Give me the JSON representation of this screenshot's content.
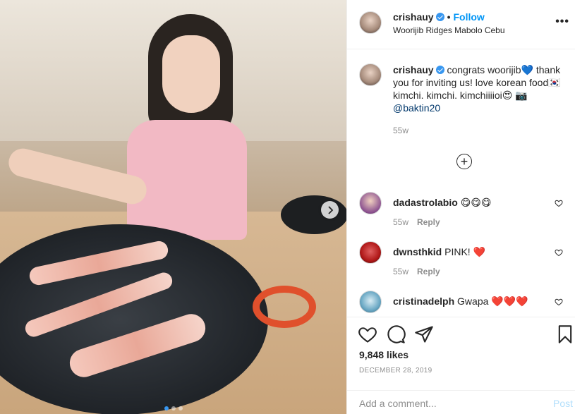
{
  "post": {
    "username": "crishauy",
    "location": "Woorijib Ridges Mabolo Cebu",
    "follow_label": "Follow",
    "separator": "•",
    "more_label": "•••",
    "caption": "congrats woorijib💙 thank you for inviting us! love korean food🇰🇷 kimchi. kimchi. kimchiiiioi😍 📷",
    "caption_mention": "@baktin20",
    "caption_time": "55w",
    "load_more": "+",
    "likes": "9,848 likes",
    "date": "DECEMBER 28, 2019"
  },
  "comments": [
    {
      "username": "dadastrolabio",
      "text": "😋😋😋",
      "time": "55w",
      "reply": "Reply"
    },
    {
      "username": "dwnsthkid",
      "text": "PINK! ❤️",
      "time": "55w",
      "reply": "Reply"
    },
    {
      "username": "cristinadelph",
      "text": "Gwapa ❤️❤️❤️",
      "time": "",
      "reply": ""
    }
  ],
  "comment_box": {
    "placeholder": "Add a comment...",
    "post_label": "Post"
  },
  "icons": [
    "verified-badge-icon",
    "more-options-icon",
    "heart-icon",
    "comment-icon",
    "share-icon",
    "bookmark-icon",
    "next-arrow-icon",
    "load-more-icon"
  ],
  "colors": {
    "accent": "#0095f6",
    "heart_red": "#ed4956",
    "carousel_active": "#3897f0"
  },
  "carousel": {
    "count": 3,
    "active": 0
  }
}
